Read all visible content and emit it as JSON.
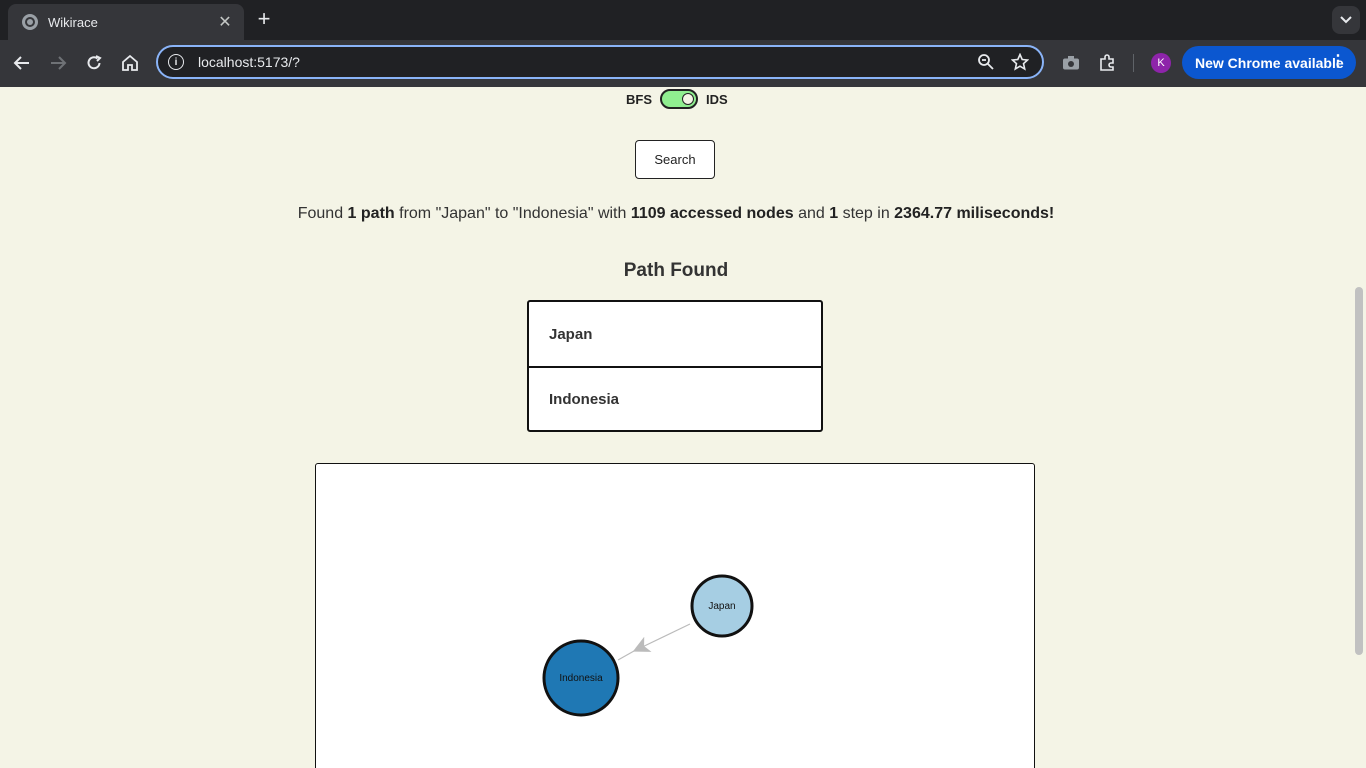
{
  "browser": {
    "tab_title": "Wikirace",
    "url": "localhost:5173/?",
    "avatar_letter": "K",
    "update_label": "New Chrome available"
  },
  "controls": {
    "left_label": "BFS",
    "right_label": "IDS",
    "toggle_state": "IDS",
    "search_label": "Search"
  },
  "result": {
    "p1": "Found ",
    "paths": "1 path",
    "p2": " from \"Japan\" to \"Indonesia\" with ",
    "nodes": "1109 accessed nodes",
    "p3": " and ",
    "steps": "1",
    "p4": " step in ",
    "time": "2364.77 miliseconds!"
  },
  "path": {
    "title": "Path Found",
    "items": [
      "Japan",
      "Indonesia"
    ]
  },
  "graph": {
    "nodes": [
      {
        "label": "Japan",
        "color": "#a6cee3",
        "role": "source"
      },
      {
        "label": "Indonesia",
        "color": "#1f78b4",
        "role": "target"
      }
    ],
    "edges": [
      {
        "from": "Japan",
        "to": "Indonesia"
      }
    ],
    "edge_color": "#bbbbbb"
  },
  "colors": {
    "page_bg": "#f4f4e6",
    "toggle_on": "#90ee90",
    "chrome_accent": "#0b57d0"
  }
}
